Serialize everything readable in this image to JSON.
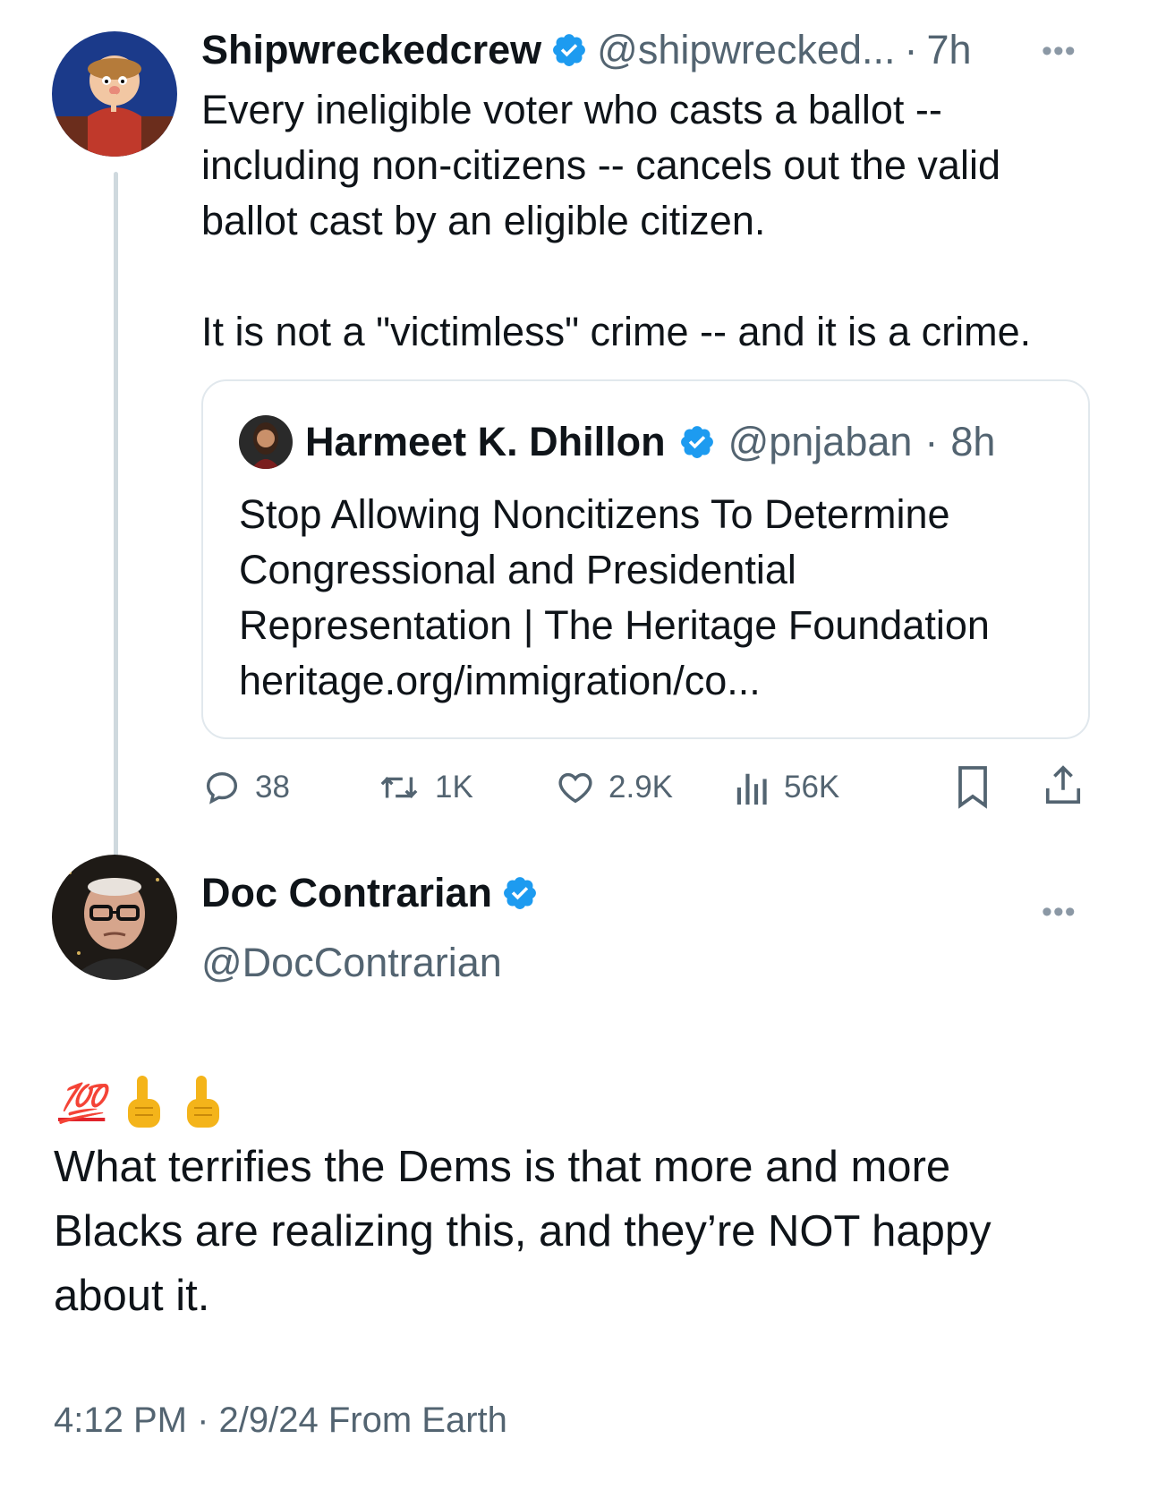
{
  "tweet1": {
    "name": "Shipwreckedcrew",
    "handle": "@shipwrecked...",
    "sep": "·",
    "time": "7h",
    "more": "•••",
    "text": "Every ineligible voter who casts a ballot --\nincluding non-citizens -- cancels out the valid\nballot cast by an eligible citizen.\n\nIt is not a \"victimless\" crime -- and it is a crime.",
    "avatar_icon": "cartoon-avatar-icon"
  },
  "quote": {
    "name": "Harmeet K. Dhillon",
    "handle": "@pnjaban",
    "sep": "·",
    "time": "8h",
    "text": "Stop Allowing Noncitizens To Determine\nCongressional and Presidential\nRepresentation | The Heritage Foundation\nheritage.org/immigration/co..."
  },
  "actions": {
    "replies": "38",
    "retweets": "1K",
    "likes": "2.9K",
    "views": "56K"
  },
  "tweet2": {
    "name": "Doc Contrarian",
    "handle": "@DocContrarian",
    "more": "•••",
    "emoji_100": "💯",
    "text": "What terrifies the Dems is that more and more\nBlacks are realizing this, and they’re NOT happy\nabout it.",
    "meta": "4:12 PM · 2/9/24 From Earth"
  },
  "colors": {
    "verified": "#1d9bf0",
    "secondary_text": "#536471",
    "thread_line": "#cfd9de",
    "emoji_red": "#e0242b",
    "hand": "#f4b41a"
  }
}
